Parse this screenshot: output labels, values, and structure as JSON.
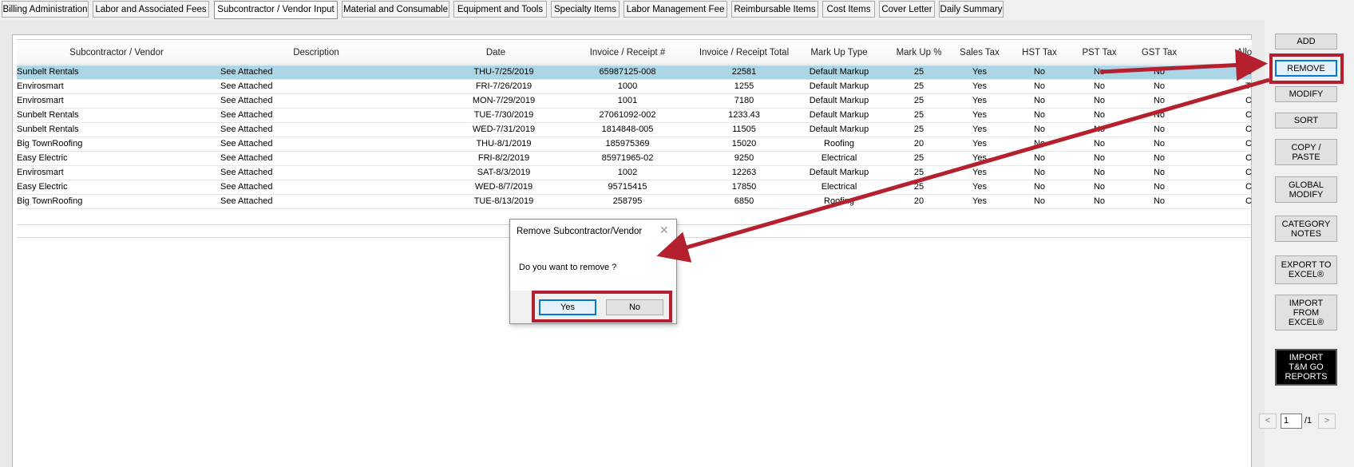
{
  "tabs": [
    {
      "label": "Billing Administration",
      "active": false
    },
    {
      "label": "Labor and Associated Fees",
      "active": false
    },
    {
      "label": "Subcontractor / Vendor Input",
      "active": true
    },
    {
      "label": "Material and Consumable",
      "active": false
    },
    {
      "label": "Equipment and Tools",
      "active": false
    },
    {
      "label": "Specialty Items",
      "active": false
    },
    {
      "label": "Labor Management Fee",
      "active": false
    },
    {
      "label": "Reimbursable Items",
      "active": false
    },
    {
      "label": "Cost Items",
      "active": false
    },
    {
      "label": "Cover Letter",
      "active": false
    },
    {
      "label": "Daily Summary",
      "active": false
    }
  ],
  "table": {
    "columns": [
      "Subcontractor / Vendor",
      "Description",
      "Date",
      "Invoice / Receipt #",
      "Invoice / Receipt Total",
      "Mark Up Type",
      "Mark Up %",
      "Sales Tax",
      "HST Tax",
      "PST Tax",
      "GST Tax",
      "Allo"
    ],
    "rows": [
      [
        " Sunbelt Rentals",
        "See Attached",
        "THU-7/25/2019",
        "65987125-008",
        "22581",
        "Default Markup",
        "25",
        "Yes",
        "No",
        "No",
        "No",
        "C"
      ],
      [
        "Envirosmart",
        "See Attached",
        "FRI-7/26/2019",
        "1000",
        "1255",
        "Default Markup",
        "25",
        "Yes",
        "No",
        "No",
        "No",
        "T"
      ],
      [
        "Envirosmart",
        "See Attached",
        "MON-7/29/2019",
        "1001",
        "7180",
        "Default Markup",
        "25",
        "Yes",
        "No",
        "No",
        "No",
        "C"
      ],
      [
        " Sunbelt Rentals",
        "See Attached",
        "TUE-7/30/2019",
        "27061092-002",
        "1233.43",
        "Default Markup",
        "25",
        "Yes",
        "No",
        "No",
        "No",
        "C"
      ],
      [
        " Sunbelt Rentals",
        "See Attached",
        "WED-7/31/2019",
        "1814848-005",
        "11505",
        "Default Markup",
        "25",
        "Yes",
        "No",
        "No",
        "No",
        "C"
      ],
      [
        " Big TownRoofing",
        "See Attached",
        "THU-8/1/2019",
        "185975369",
        "15020",
        "Roofing",
        "20",
        "Yes",
        "No",
        "No",
        "No",
        "C"
      ],
      [
        " Easy Electric",
        "See Attached",
        "FRI-8/2/2019",
        "85971965-02",
        "9250",
        "Electrical",
        "25",
        "Yes",
        "No",
        "No",
        "No",
        "C"
      ],
      [
        "Envirosmart",
        "See Attached",
        "SAT-8/3/2019",
        "1002",
        "12263",
        "Default Markup",
        "25",
        "Yes",
        "No",
        "No",
        "No",
        "C"
      ],
      [
        " Easy Electric",
        "See Attached",
        "WED-8/7/2019",
        "95715415",
        "17850",
        "Electrical",
        "25",
        "Yes",
        "No",
        "No",
        "No",
        "C"
      ],
      [
        " Big TownRoofing",
        "See Attached",
        "TUE-8/13/2019",
        "258795",
        "6850",
        "Roofing",
        "20",
        "Yes",
        "No",
        "No",
        "No",
        "C"
      ]
    ],
    "selected_row": 0
  },
  "sidebar": {
    "add": "ADD",
    "remove": "REMOVE",
    "modify": "MODIFY",
    "sort": "SORT",
    "copy_paste": "COPY /\nPASTE",
    "global_modify": "GLOBAL\nMODIFY",
    "category_notes": "CATEGORY\nNOTES",
    "export_excel": "EXPORT TO\nEXCEL®",
    "import_excel": "IMPORT\nFROM\nEXCEL®",
    "import_tm": "IMPORT\nT&M GO\nREPORTS"
  },
  "pager": {
    "prev": "<",
    "page": "1",
    "total": "/1",
    "next": ">"
  },
  "dialog": {
    "title": "Remove Subcontractor/Vendor",
    "message": "Do you want to remove ?",
    "yes": "Yes",
    "no": "No",
    "close": "✕"
  },
  "annotation_color": "#b5202e",
  "selection_color": "#acd5e6"
}
